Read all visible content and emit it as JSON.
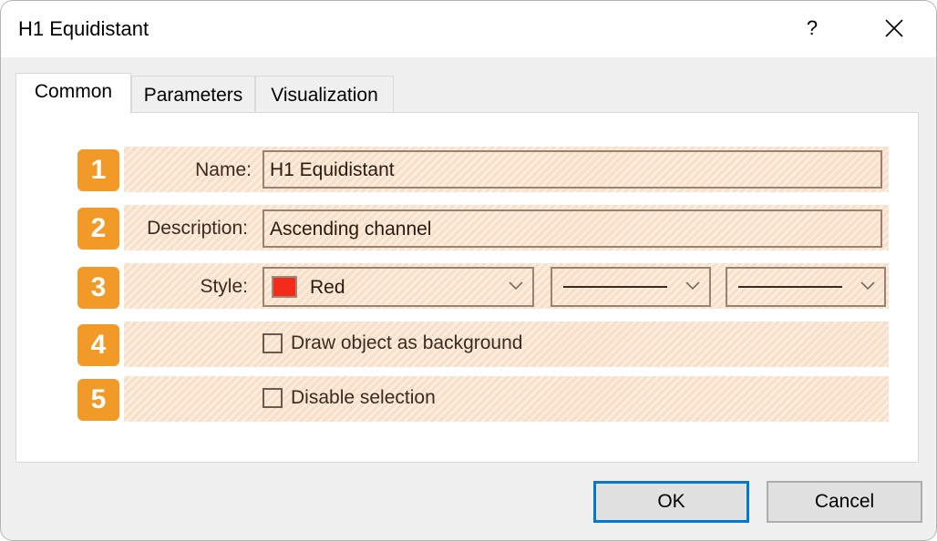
{
  "window": {
    "title": "H1 Equidistant",
    "help_label": "?",
    "close_icon": "close-icon"
  },
  "tabs": [
    {
      "label": "Common",
      "active": true
    },
    {
      "label": "Parameters",
      "active": false
    },
    {
      "label": "Visualization",
      "active": false
    }
  ],
  "form": {
    "name": {
      "badge": "1",
      "label": "Name:",
      "value": "H1 Equidistant"
    },
    "description": {
      "badge": "2",
      "label": "Description:",
      "value": "Ascending channel"
    },
    "style": {
      "badge": "3",
      "label": "Style:",
      "color_name": "Red",
      "color_hex": "#f42a1a",
      "line_style": "solid",
      "line_width": "thin"
    },
    "draw_background": {
      "badge": "4",
      "label": "Draw object as background",
      "checked": false
    },
    "disable_selection": {
      "badge": "5",
      "label": "Disable selection",
      "checked": false
    }
  },
  "buttons": {
    "ok": "OK",
    "cancel": "Cancel"
  },
  "colors": {
    "badge": "#f29a27",
    "highlight": "#f9e0c8",
    "default_button_border": "#0078d7"
  }
}
